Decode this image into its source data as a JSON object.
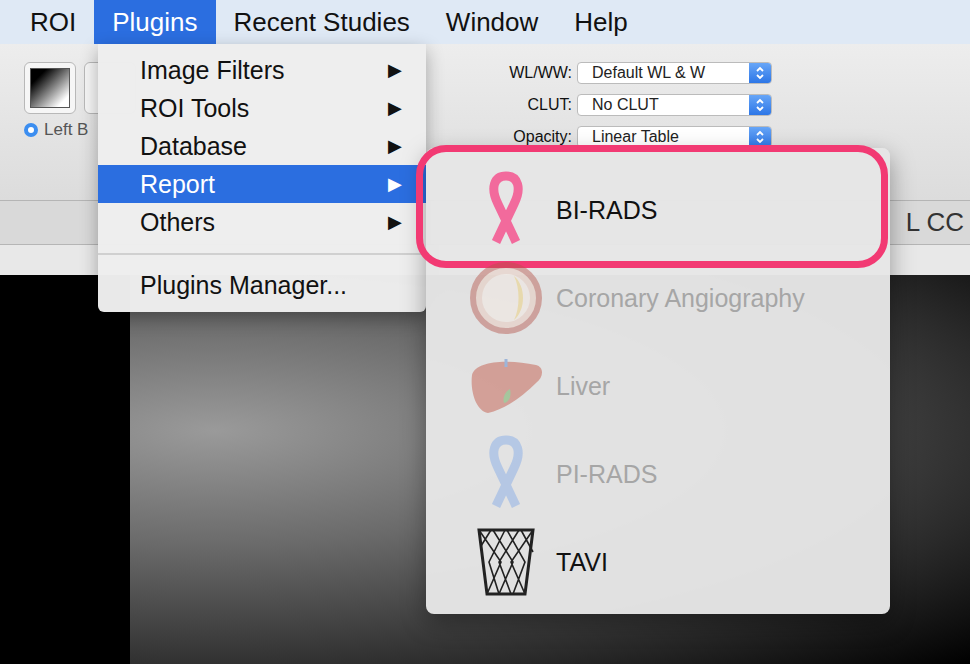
{
  "menubar": [
    {
      "label": "ROI",
      "selected": false
    },
    {
      "label": "Plugins",
      "selected": true
    },
    {
      "label": "Recent Studies",
      "selected": false
    },
    {
      "label": "Window",
      "selected": false
    },
    {
      "label": "Help",
      "selected": false
    }
  ],
  "toolbar": {
    "radio": {
      "label": "Left B",
      "selected": true
    },
    "fields": [
      {
        "label": "WL/WW:",
        "value": "Default WL & W"
      },
      {
        "label": "CLUT:",
        "value": "No CLUT"
      },
      {
        "label": "Opacity:",
        "value": "Linear Table"
      }
    ]
  },
  "viewer": {
    "tab": "L CC"
  },
  "plugins_menu": {
    "arrow": "▶",
    "groups": [
      [
        {
          "label": "Image Filters",
          "submenu": true,
          "selected": false
        },
        {
          "label": "ROI Tools",
          "submenu": true,
          "selected": false
        },
        {
          "label": "Database",
          "submenu": true,
          "selected": false
        },
        {
          "label": "Report",
          "submenu": true,
          "selected": true
        },
        {
          "label": "Others",
          "submenu": true,
          "selected": false
        }
      ],
      [
        {
          "label": "Plugins Manager...",
          "submenu": false,
          "selected": false
        }
      ]
    ]
  },
  "report_submenu": {
    "items": [
      {
        "label": "BI-RADS",
        "kind": "ribbon",
        "color": "#f26a9c",
        "disabled": false,
        "highlighted": true
      },
      {
        "label": "Coronary Angiography",
        "kind": "artery",
        "disabled": false,
        "highlighted": false
      },
      {
        "label": "Liver",
        "kind": "liver",
        "disabled": true,
        "highlighted": false
      },
      {
        "label": "PI-RADS",
        "kind": "ribbon",
        "color": "#7fa8e8",
        "disabled": true,
        "highlighted": false
      },
      {
        "label": "TAVI",
        "kind": "valve",
        "disabled": false,
        "highlighted": false
      }
    ]
  }
}
